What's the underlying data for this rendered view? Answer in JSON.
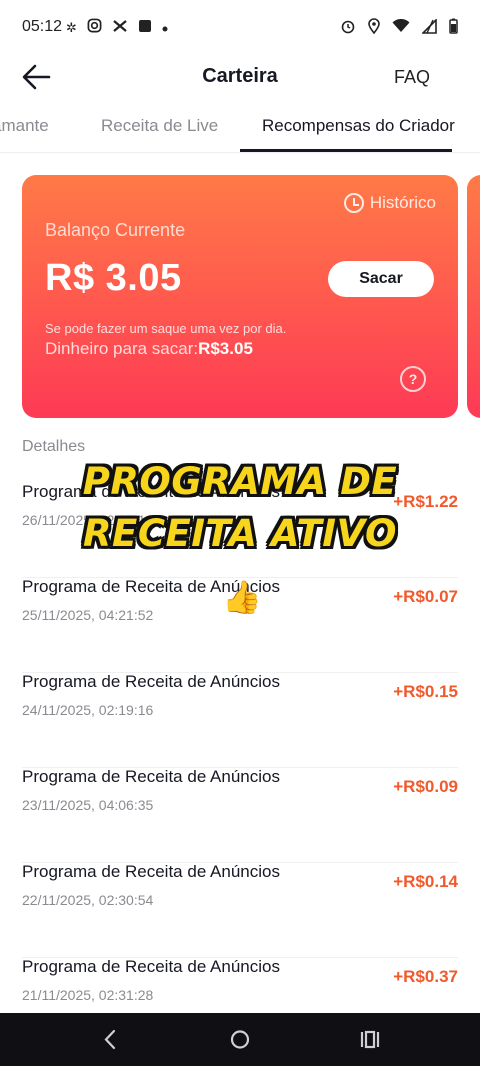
{
  "status_bar": {
    "time": "05:12",
    "left_icons": [
      "link-icon",
      "instagram-icon",
      "capcut-icon",
      "app-icon",
      "dot-icon"
    ],
    "right_icons": [
      "alarm-icon",
      "location-icon",
      "wifi-icon",
      "signal-icon",
      "battery-icon"
    ]
  },
  "header": {
    "title": "Carteira",
    "faq": "FAQ"
  },
  "tabs": [
    {
      "label": "amante"
    },
    {
      "label": "Receita de Live"
    },
    {
      "label": "Recompensas do Criador",
      "active": true
    }
  ],
  "balance_card": {
    "history": "Histórico",
    "label": "Balanço Currente",
    "value": "R$ 3.05",
    "withdraw_button": "Sacar",
    "note": "Se pode fazer um saque uma vez por dia.",
    "available_label": "Dinheiro para sacar:",
    "available_value": "R$3.05",
    "help": "?"
  },
  "details": {
    "heading": "Detalhes",
    "items": [
      {
        "title": "Programa de Receita de Anúncios",
        "date": "26/11/2025, 02:44:18",
        "amount": "+R$1.22"
      },
      {
        "title": "Programa de Receita de Anúncios",
        "date": "25/11/2025, 04:21:52",
        "amount": "+R$0.07"
      },
      {
        "title": "Programa de Receita de Anúncios",
        "date": "24/11/2025, 02:19:16",
        "amount": "+R$0.15"
      },
      {
        "title": "Programa de Receita de Anúncios",
        "date": "23/11/2025, 04:06:35",
        "amount": "+R$0.09"
      },
      {
        "title": "Programa de Receita de Anúncios",
        "date": "22/11/2025, 02:30:54",
        "amount": "+R$0.14"
      },
      {
        "title": "Programa de Receita de Anúncios",
        "date": "21/11/2025, 02:31:28",
        "amount": "+R$0.37"
      }
    ]
  },
  "overlay": {
    "line1": "PROGRAMA DE",
    "line2": "RECEITA ATIVO",
    "emoji": "👍"
  },
  "colors": {
    "accent": "#f05a2c",
    "card_top": "#ff7a47",
    "card_bottom": "#fe3a55",
    "overlay_text": "#f7d51d"
  }
}
